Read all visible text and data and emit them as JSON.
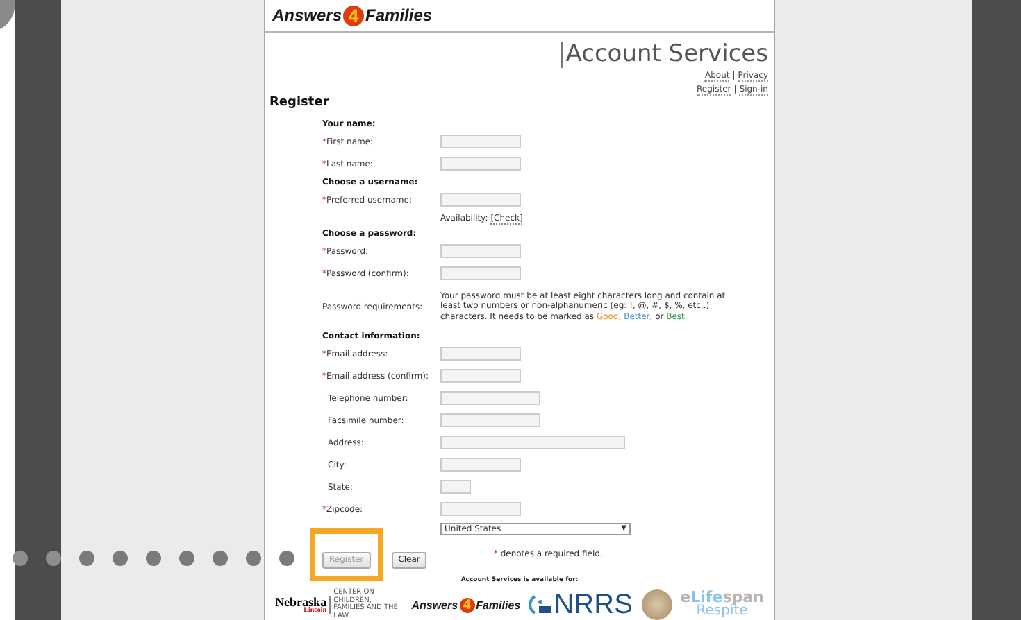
{
  "logo": {
    "left": "Answers",
    "number": "4",
    "right": "Families"
  },
  "title": "Account Services",
  "links": [
    [
      "About",
      "|",
      "Privacy"
    ],
    [
      "Register",
      "|",
      "Sign-in"
    ]
  ],
  "heading": "Register",
  "required_mark": "*",
  "form": [
    {
      "kind": "heading",
      "label": "Your name:"
    },
    {
      "kind": "field",
      "label": "First name:",
      "required": true
    },
    {
      "kind": "field",
      "label": "Last name:",
      "required": true
    },
    {
      "kind": "heading",
      "label": "Choose a username:"
    },
    {
      "kind": "field",
      "label": "Preferred username:",
      "required": true
    },
    {
      "kind": "note",
      "label": "Availability:",
      "link": "[Check]"
    },
    {
      "kind": "heading",
      "label": "Choose a password:"
    },
    {
      "kind": "field",
      "label": "Password:",
      "required": true
    },
    {
      "kind": "field",
      "label": "Password (confirm):",
      "required": true
    },
    {
      "kind": "requirements",
      "label": "Password requirements:",
      "parts": [
        {
          "text": "Your password must be at least eight characters long and contain at least two numbers or non-alphanumeric (eg: !, @, #, $, %, etc..) characters. It needs to be marked as "
        },
        {
          "text": "Good",
          "color": "#f08a24"
        },
        {
          "text": ", "
        },
        {
          "text": "Better",
          "color": "#4a8ed0"
        },
        {
          "text": ", or "
        },
        {
          "text": "Best",
          "color": "#2f9a48"
        },
        {
          "text": "."
        }
      ]
    },
    {
      "kind": "heading",
      "label": "Contact information:"
    },
    {
      "kind": "field",
      "label": "Email address:",
      "required": true
    },
    {
      "kind": "field",
      "label": "Email address (confirm):",
      "required": true
    },
    {
      "kind": "field",
      "label": "Telephone number:",
      "required": false
    },
    {
      "kind": "field",
      "label": "Facsimile number:",
      "required": false
    },
    {
      "kind": "field",
      "label": "Address:",
      "required": false
    },
    {
      "kind": "field",
      "label": "City:",
      "required": false
    },
    {
      "kind": "field",
      "label": "State:",
      "required": false
    },
    {
      "kind": "field",
      "label": "Zipcode:",
      "required": true
    },
    {
      "kind": "select",
      "value": "United States",
      "caret": "▼"
    }
  ],
  "buttons": [
    {
      "label": "Register",
      "disabled": true,
      "highlighted": true
    },
    {
      "label": "Clear",
      "disabled": false,
      "highlighted": false
    }
  ],
  "required_note": "denotes a required field.",
  "footer": {
    "caption": "Account Services is available for:",
    "logos": [
      {
        "kind": "university",
        "name": "Nebraska",
        "sub": "Lincoln",
        "unit": "CENTER ON CHILDREN, FAMILIES AND THE LAW"
      },
      {
        "kind": "a4f",
        "left": "Answers",
        "number": "4",
        "right": "Families"
      },
      {
        "kind": "nrrs",
        "name": "NRRS"
      },
      {
        "kind": "seal"
      },
      {
        "kind": "lifespan",
        "prefix": "e",
        "name": "Lifespan",
        "sub": "Respite"
      }
    ]
  }
}
